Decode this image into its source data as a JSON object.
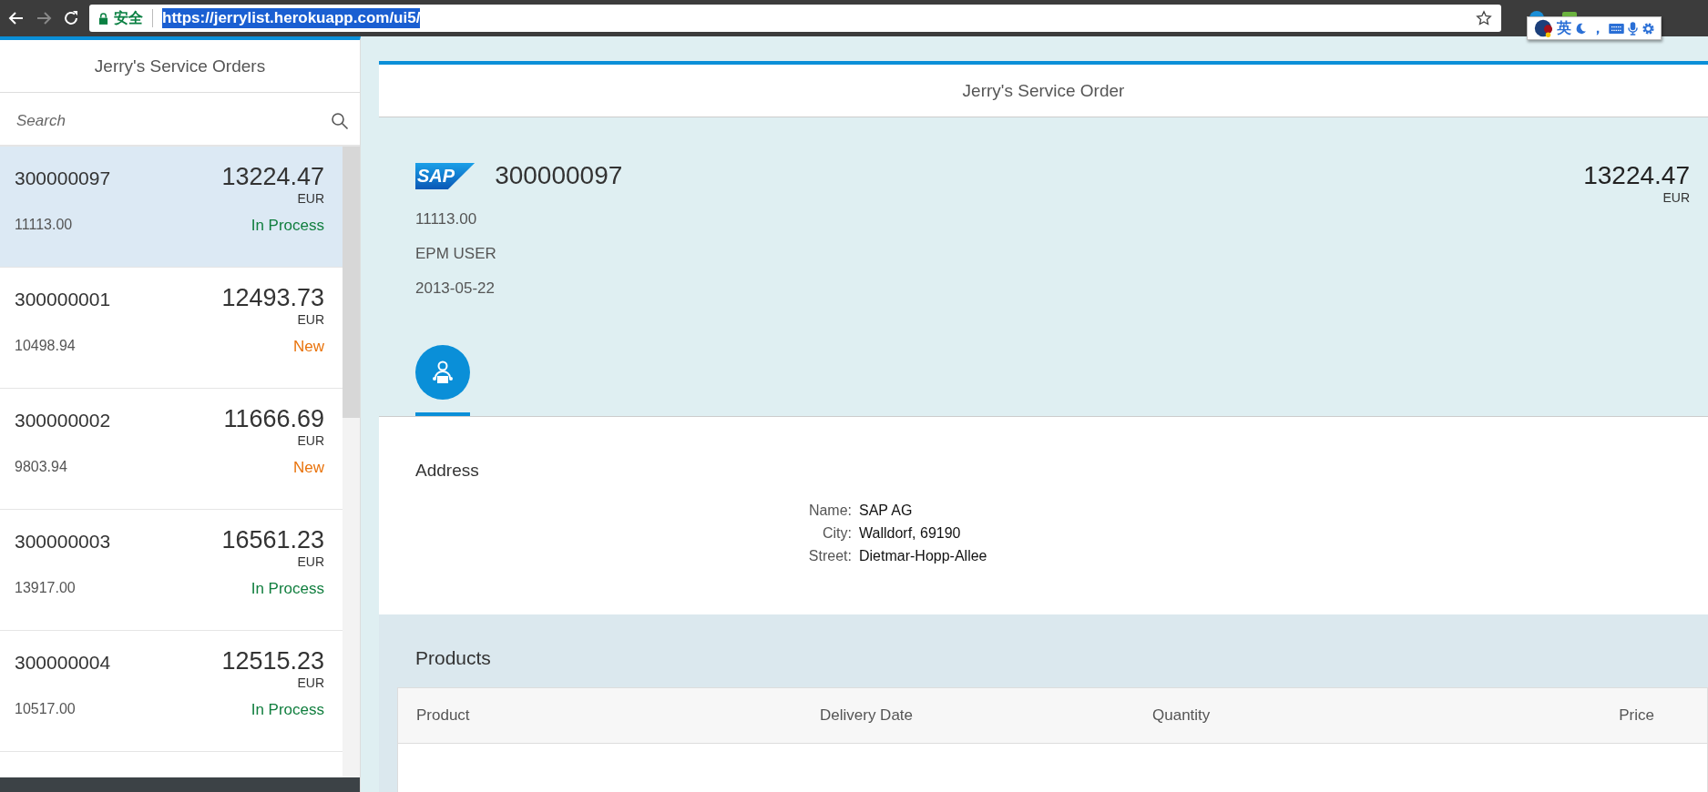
{
  "browser": {
    "security_label": "安全",
    "url": "https://jerrylist.herokuapp.com/ui5/",
    "ime": {
      "mode": "英",
      "punct": "，"
    }
  },
  "master": {
    "title": "Jerry's Service Orders",
    "search": {
      "placeholder": "Search"
    },
    "orders": [
      {
        "id": "300000097",
        "amount": "13224.47",
        "currency": "EUR",
        "net": "11113.00",
        "status": "In Process",
        "color": "#107e3e",
        "selected": true
      },
      {
        "id": "300000001",
        "amount": "12493.73",
        "currency": "EUR",
        "net": "10498.94",
        "status": "New",
        "color": "#e9730c",
        "selected": false
      },
      {
        "id": "300000002",
        "amount": "11666.69",
        "currency": "EUR",
        "net": "9803.94",
        "status": "New",
        "color": "#e9730c",
        "selected": false
      },
      {
        "id": "300000003",
        "amount": "16561.23",
        "currency": "EUR",
        "net": "13917.00",
        "status": "In Process",
        "color": "#107e3e",
        "selected": false
      },
      {
        "id": "300000004",
        "amount": "12515.23",
        "currency": "EUR",
        "net": "10517.00",
        "status": "In Process",
        "color": "#107e3e",
        "selected": false
      }
    ]
  },
  "detail": {
    "title": "Jerry's Service Order",
    "header": {
      "logo": "SAP",
      "number": "300000097",
      "amount": "13224.47",
      "currency": "EUR",
      "attributes": [
        "11113.00",
        "EPM USER",
        "2013-05-22"
      ]
    },
    "tabs": [
      {
        "kind": "supplier",
        "selected": true
      }
    ],
    "address": {
      "title": "Address",
      "fields": [
        {
          "label": "Name:",
          "value": "SAP AG"
        },
        {
          "label": "City:",
          "value": "Walldorf, 69190"
        },
        {
          "label": "Street:",
          "value": "Dietmar-Hopp-Allee"
        }
      ]
    },
    "products": {
      "title": "Products",
      "columns": [
        "Product",
        "Delivery Date",
        "Quantity",
        "Price"
      ]
    }
  }
}
